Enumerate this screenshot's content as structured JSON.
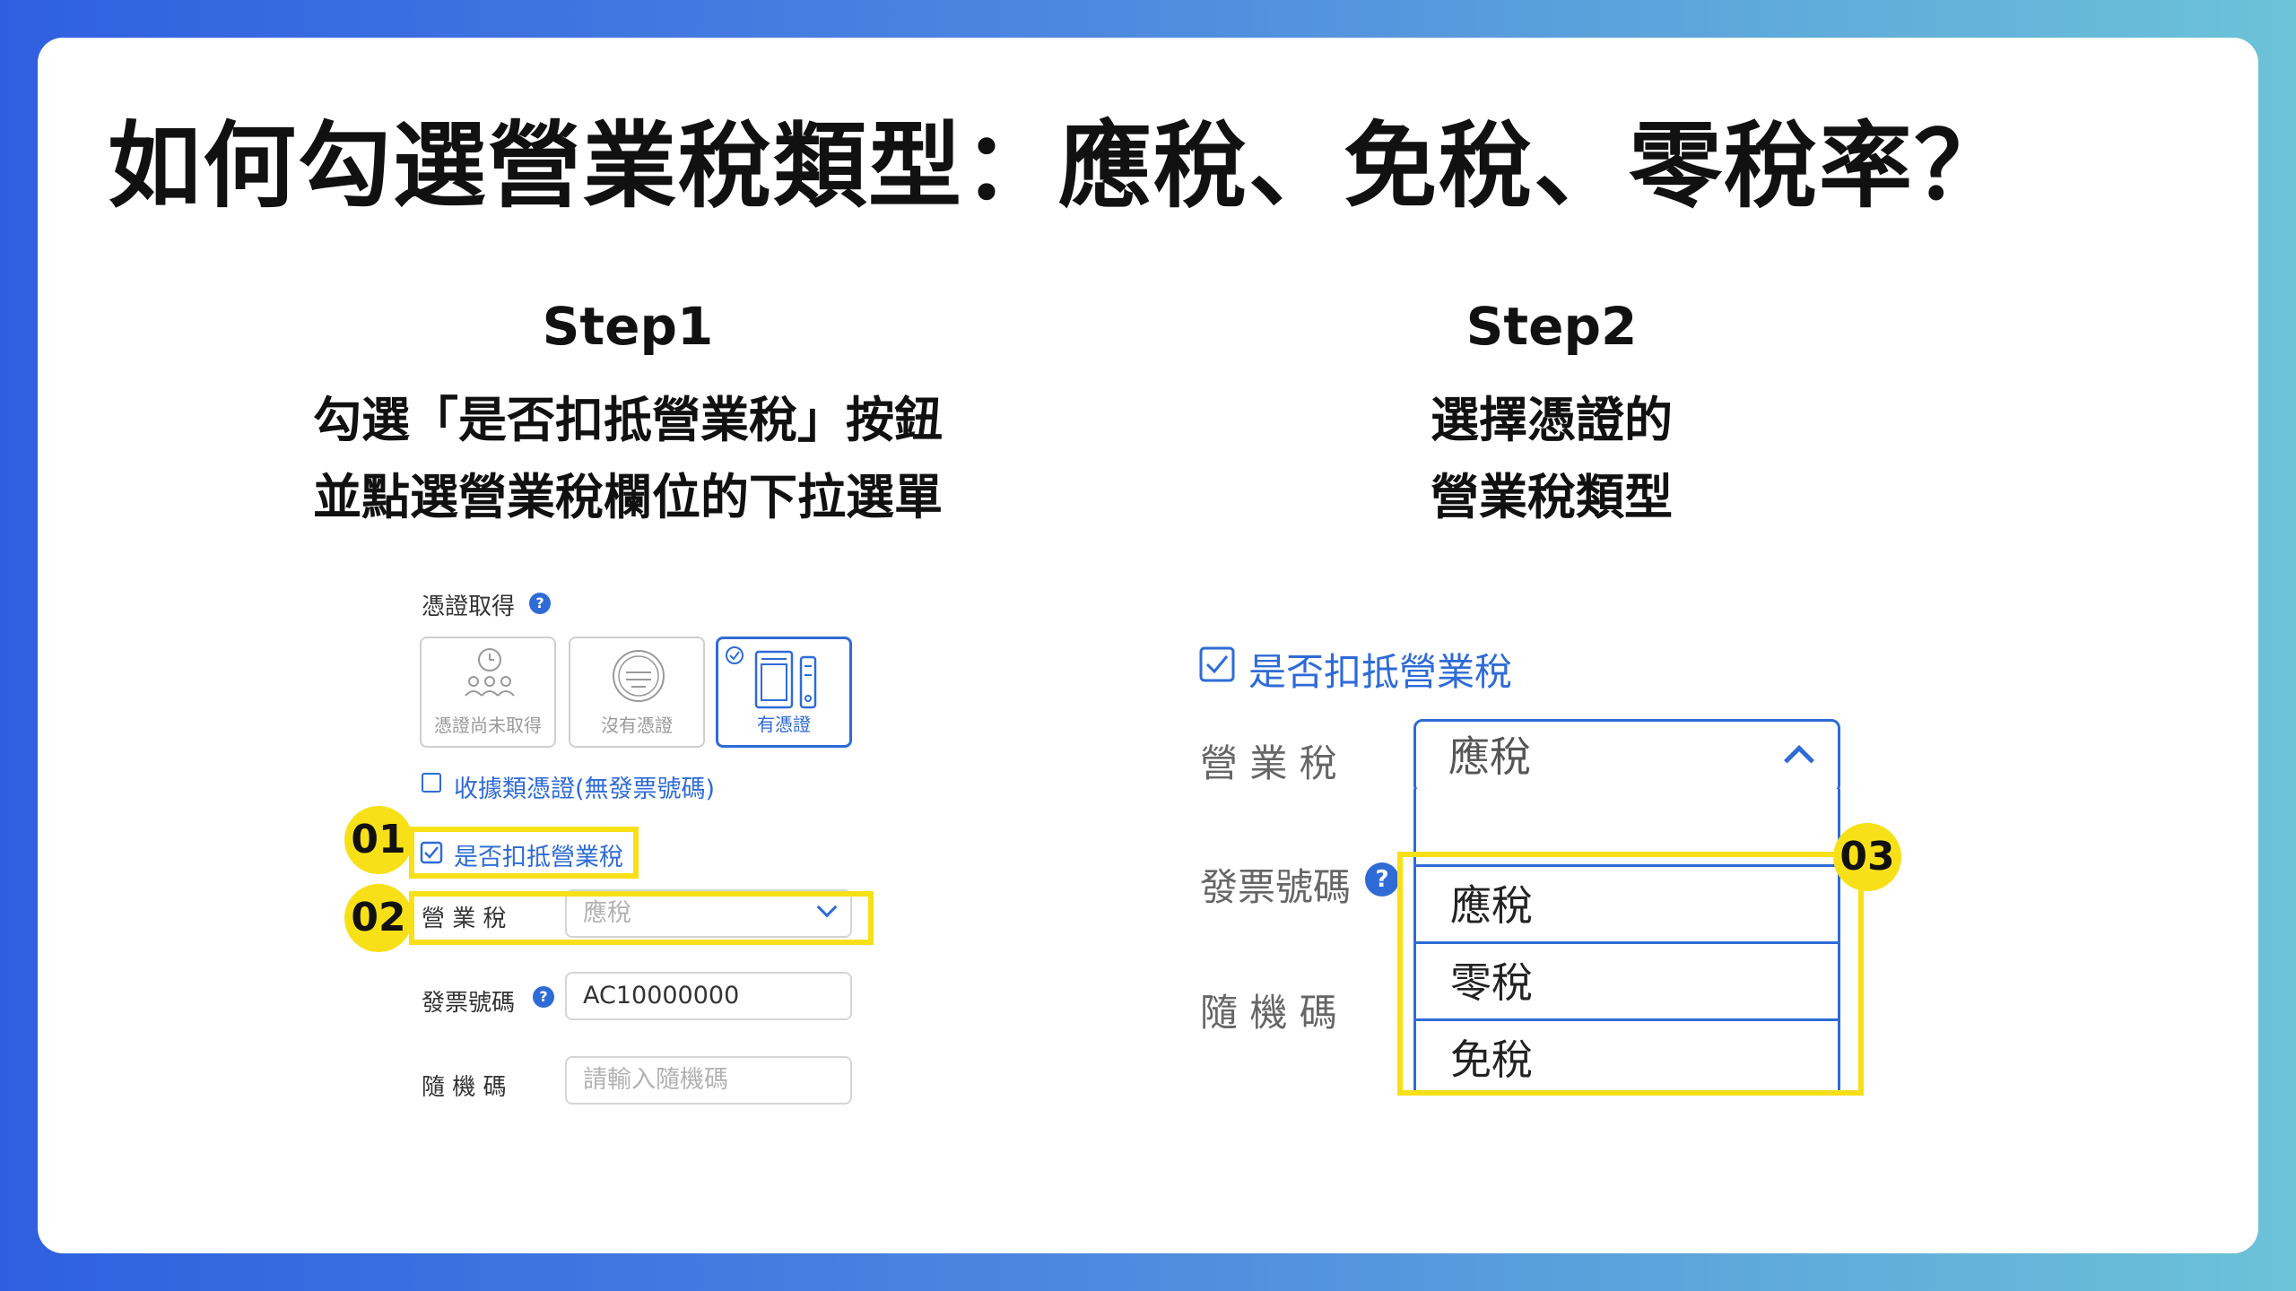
{
  "title": "如何勾選營業稅類型：應稅、免稅、零稅率？",
  "step1": {
    "label": "Step1",
    "line1": "勾選「是否扣抵營業稅」按鈕",
    "line2": "並點選營業稅欄位的下拉選單",
    "form": {
      "cert_acquired_label": "憑證取得",
      "help_mark": "?",
      "options": [
        {
          "label": "憑證尚未取得",
          "icon": "people-clock-icon"
        },
        {
          "label": "沒有憑證",
          "icon": "stamp-icon"
        },
        {
          "label": "有憑證",
          "icon": "document-phone-icon",
          "selected": true
        }
      ],
      "receipt_checkbox_label": "收據類憑證(無發票號碼)",
      "deduct_checkbox_label": "是否扣抵營業稅",
      "tax_label": "營 業 稅",
      "tax_value": "應稅",
      "invoice_label": "發票號碼",
      "invoice_value": "AC10000000",
      "random_label": "隨 機 碼",
      "random_placeholder": "請輸入隨機碼"
    },
    "badges": [
      "01",
      "02"
    ]
  },
  "step2": {
    "label": "Step2",
    "line1": "選擇憑證的",
    "line2": "營業稅類型",
    "form": {
      "deduct_checkbox_label": "是否扣抵營業稅",
      "tax_label": "營 業 稅",
      "tax_value": "應稅",
      "invoice_label": "發票號碼",
      "help_mark": "?",
      "random_label": "隨 機 碼",
      "dropdown_options": [
        "應稅",
        "零稅",
        "免稅"
      ]
    },
    "badge": "03"
  },
  "colors": {
    "accent": "#2e6bd6",
    "highlight": "#f7e017"
  }
}
